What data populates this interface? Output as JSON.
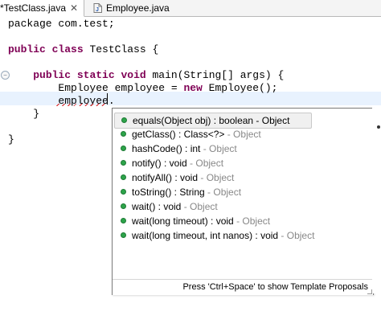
{
  "tabs": [
    {
      "label": "*TestClass.java",
      "close": "✕",
      "active": true
    },
    {
      "label": "Employee.java",
      "active": false
    }
  ],
  "code": {
    "line1": "package com.test;",
    "line2_kw1": "public",
    "line2_kw2": "class",
    "line2_rest": " TestClass {",
    "line3_kw1": "public",
    "line3_kw2": "static",
    "line3_kw3": "void",
    "line3_rest": " main(String[] args) {",
    "line4_a": "Employee employee = ",
    "line4_kw": "new",
    "line4_b": " Employee();",
    "line5": "employee.",
    "line6": "}",
    "line7": "}"
  },
  "assist": {
    "proposals": [
      {
        "sig": "equals(Object obj) : boolean",
        "owner": " - Object",
        "selected": true
      },
      {
        "sig": "getClass() : Class<?>",
        "owner": " - Object",
        "selected": false
      },
      {
        "sig": "hashCode() : int",
        "owner": " - Object",
        "selected": false
      },
      {
        "sig": "notify() : void",
        "owner": " - Object",
        "selected": false
      },
      {
        "sig": "notifyAll() : void",
        "owner": " - Object",
        "selected": false
      },
      {
        "sig": "toString() : String",
        "owner": " - Object",
        "selected": false
      },
      {
        "sig": "wait() : void",
        "owner": " - Object",
        "selected": false
      },
      {
        "sig": "wait(long timeout) : void",
        "owner": " - Object",
        "selected": false
      },
      {
        "sig": "wait(long timeout, int nanos) : void",
        "owner": " - Object",
        "selected": false
      }
    ],
    "footer": "Press 'Ctrl+Space' to show Template Proposals"
  },
  "colors": {
    "keyword": "#7f0055",
    "method_dot": "#2da44a",
    "current_line": "#e8f2fe"
  },
  "icons": {
    "java_file": "java-file-icon",
    "method_public": "public-method-icon",
    "override_marker": "override-marker-icon"
  }
}
